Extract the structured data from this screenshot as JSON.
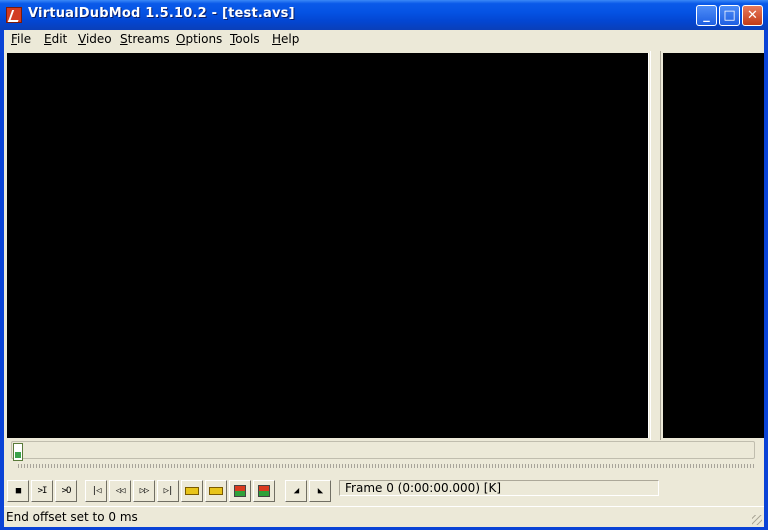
{
  "window": {
    "title": "VirtualDubMod 1.5.10.2 - [test.avs]",
    "controls": {
      "minimize": "_",
      "maximize": "□",
      "close": "✕"
    }
  },
  "menu": {
    "items": [
      {
        "label": "File"
      },
      {
        "label": "Edit"
      },
      {
        "label": "Video"
      },
      {
        "label": "Streams"
      },
      {
        "label": "Options"
      },
      {
        "label": "Tools"
      },
      {
        "label": "Help"
      }
    ]
  },
  "position_slider": {
    "value": 0
  },
  "toolbar": {
    "buttons": [
      {
        "name": "stop-button",
        "icon": "stop-icon",
        "glyph": "■"
      },
      {
        "name": "play-input-button",
        "icon": "play-input-icon",
        "glyph": ">I"
      },
      {
        "name": "play-output-button",
        "icon": "play-output-icon",
        "glyph": ">O"
      },
      {
        "name": "go-start-button",
        "icon": "go-start-icon",
        "glyph": "|◁"
      },
      {
        "name": "step-back-button",
        "icon": "step-back-icon",
        "glyph": "◁◁"
      },
      {
        "name": "step-forward-button",
        "icon": "step-forward-icon",
        "glyph": "▷▷"
      },
      {
        "name": "go-end-button",
        "icon": "go-end-icon",
        "glyph": "▷|"
      },
      {
        "name": "prev-keyframe-button",
        "icon": "key-prev-icon"
      },
      {
        "name": "next-keyframe-button",
        "icon": "key-next-icon"
      },
      {
        "name": "prev-scene-button",
        "icon": "scene-prev-icon"
      },
      {
        "name": "next-scene-button",
        "icon": "scene-next-icon"
      },
      {
        "name": "mark-in-button",
        "icon": "mark-in-icon",
        "glyph": "◢"
      },
      {
        "name": "mark-out-button",
        "icon": "mark-out-icon",
        "glyph": "◣"
      }
    ],
    "frame_indicator": "Frame 0 (0:00:00.000) [K]"
  },
  "status": {
    "text": "End offset set to 0 ms"
  }
}
